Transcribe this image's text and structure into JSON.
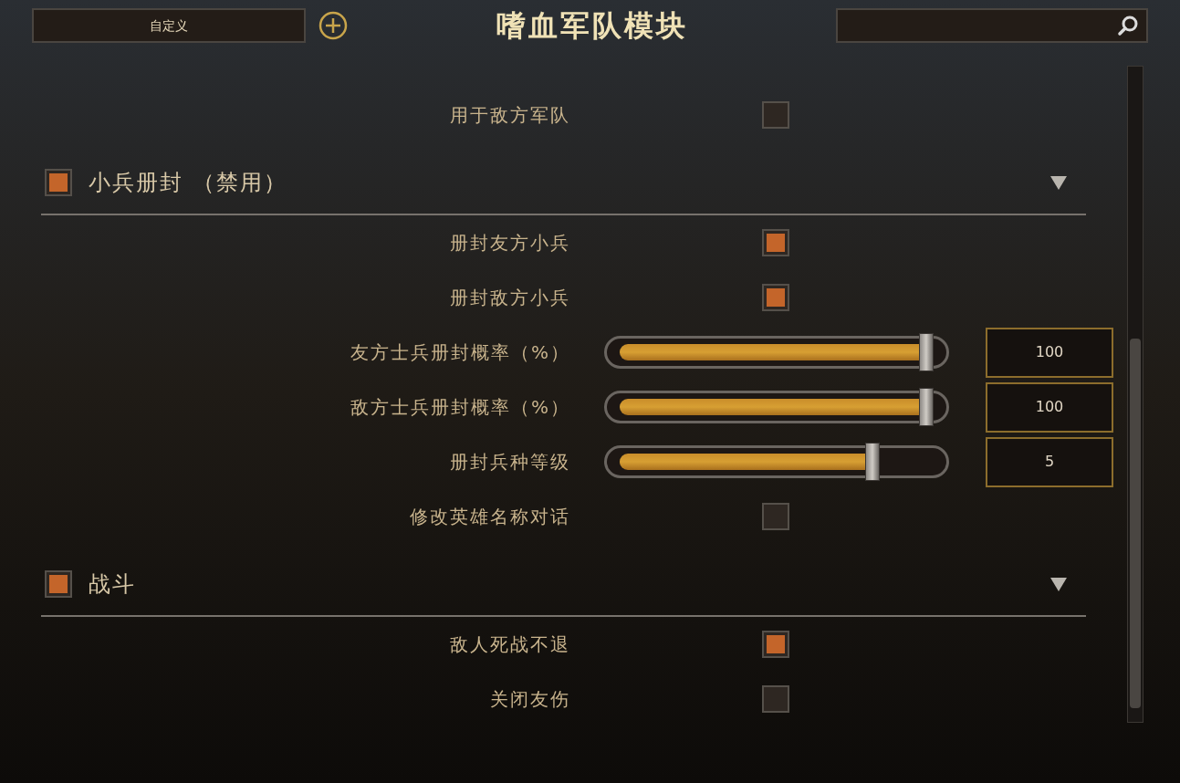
{
  "header": {
    "preset": "自定义",
    "title": "嗜血军队模块"
  },
  "items": [
    {
      "kind": "checkbox",
      "label": "用于敌方军队",
      "checked": false
    },
    {
      "kind": "section",
      "label": "小兵册封 （禁用）",
      "checked": true,
      "expanded": true
    },
    {
      "kind": "checkbox",
      "label": "册封友方小兵",
      "checked": true
    },
    {
      "kind": "checkbox",
      "label": "册封敌方小兵",
      "checked": true
    },
    {
      "kind": "slider",
      "label": "友方士兵册封概率（%）",
      "level": 1,
      "value": "100"
    },
    {
      "kind": "slider",
      "label": "敌方士兵册封概率（%）",
      "level": 1,
      "value": "100"
    },
    {
      "kind": "slider",
      "label": "册封兵种等级",
      "level": 0.82,
      "value": "5"
    },
    {
      "kind": "checkbox",
      "label": "修改英雄名称对话",
      "checked": false
    },
    {
      "kind": "section",
      "label": "战斗",
      "checked": true,
      "expanded": true
    },
    {
      "kind": "checkbox",
      "label": "敌人死战不退",
      "checked": true
    },
    {
      "kind": "checkbox",
      "label": "关闭友伤",
      "checked": false
    }
  ]
}
